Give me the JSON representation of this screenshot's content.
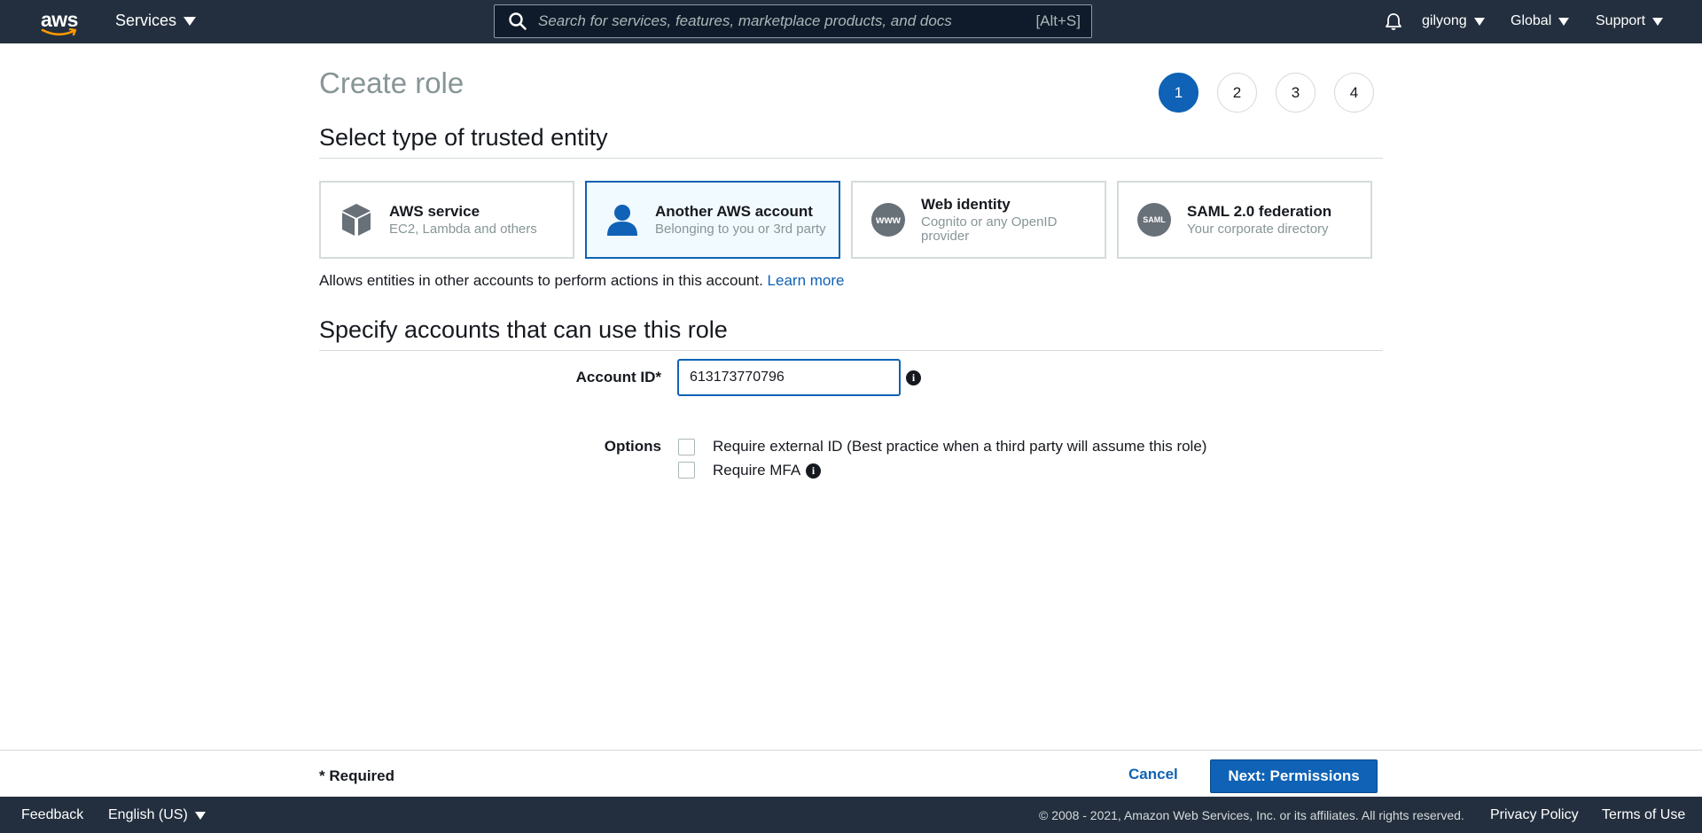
{
  "nav": {
    "logo_text": "aws",
    "services_label": "Services",
    "search_placeholder": "Search for services, features, marketplace products, and docs",
    "search_shortcut": "[Alt+S]",
    "user_label": "gilyong",
    "region_label": "Global",
    "support_label": "Support"
  },
  "page": {
    "title": "Create role",
    "steps": [
      "1",
      "2",
      "3",
      "4"
    ],
    "active_step": "1"
  },
  "entity_section": {
    "title": "Select type of trusted entity",
    "tiles": [
      {
        "title": "AWS service",
        "subtitle": "EC2, Lambda and others",
        "icon": "cube-icon"
      },
      {
        "title": "Another AWS account",
        "subtitle": "Belonging to you or 3rd party",
        "icon": "user-icon"
      },
      {
        "title": "Web identity",
        "subtitle": "Cognito or any OpenID provider",
        "icon": "www-icon"
      },
      {
        "title": "SAML 2.0 federation",
        "subtitle": "Your corporate directory",
        "icon": "saml-icon"
      }
    ],
    "www_text": "www",
    "saml_text": "SAML",
    "description": "Allows entities in other accounts to perform actions in this account.",
    "learn_more": "Learn more"
  },
  "accounts_section": {
    "title": "Specify accounts that can use this role",
    "account_id_label": "Account ID*",
    "account_id_value": "613173770796",
    "options_label": "Options",
    "option_external_id": "Require external ID (Best practice when a third party will assume this role)",
    "option_mfa": "Require MFA"
  },
  "info_glyph": "i",
  "action_bar": {
    "required_note": "* Required",
    "cancel_label": "Cancel",
    "next_label": "Next: Permissions"
  },
  "footer": {
    "feedback": "Feedback",
    "language": "English (US)",
    "copyright": "© 2008 - 2021, Amazon Web Services, Inc. or its affiliates. All rights reserved.",
    "privacy": "Privacy Policy",
    "terms": "Terms of Use"
  },
  "colors": {
    "nav_bg": "#232f3e",
    "accent": "#0f62b5",
    "selected_tile_bg": "#f1faff",
    "muted_text": "#879596"
  }
}
